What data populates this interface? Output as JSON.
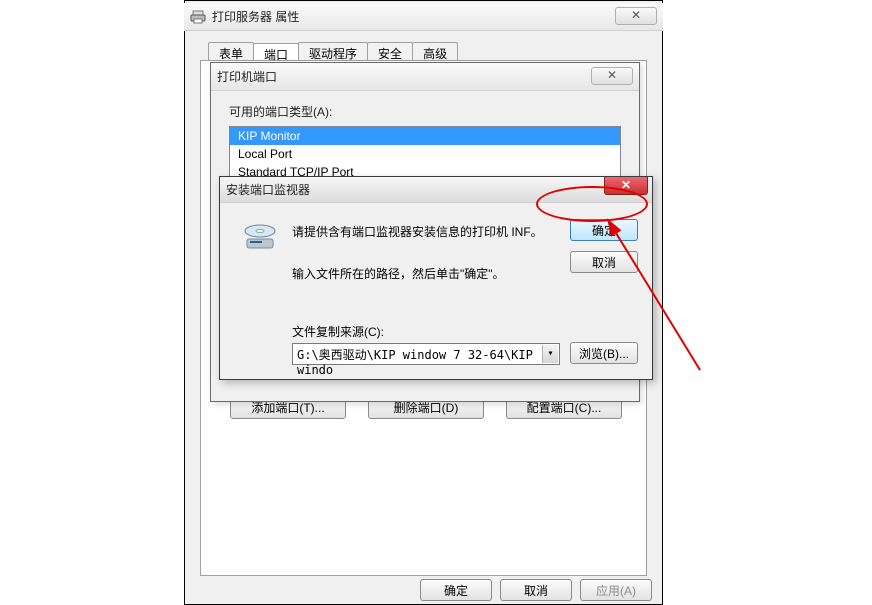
{
  "main": {
    "title": "打印服务器 属性",
    "close_glyph": "✕",
    "tabs": [
      "表单",
      "端口",
      "驱动程序",
      "安全",
      "高级"
    ],
    "active_tab_index": 1,
    "buttons": {
      "ok": "确定",
      "cancel": "取消",
      "apply": "应用(A)"
    }
  },
  "port_dialog": {
    "title": "打印机端口",
    "close_glyph": "✕",
    "group_label": "可用的端口类型(A):",
    "items": [
      "KIP Monitor",
      "Local Port",
      "Standard TCP/IP Port"
    ],
    "selected_index": 0,
    "buttons": {
      "add": "添加端口(T)...",
      "delete": "删除端口(D)",
      "configure": "配置端口(C)..."
    }
  },
  "install_dialog": {
    "title": "安装端口监视器",
    "close_glyph": "✕",
    "text1": "请提供含有端口监视器安装信息的打印机 INF。",
    "text2": "输入文件所在的路径，然后单击\"确定\"。",
    "src_label": "文件复制来源(C):",
    "path_value": "G:\\奥西驱动\\KIP window 7 32-64\\KIP windo",
    "buttons": {
      "ok": "确定",
      "cancel": "取消",
      "browse": "浏览(B)..."
    }
  }
}
